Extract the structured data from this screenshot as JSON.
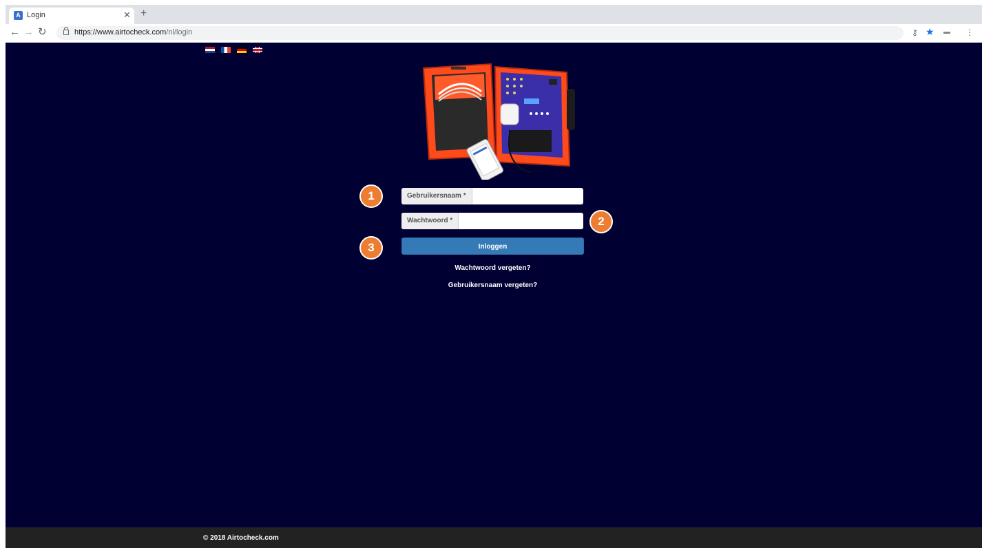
{
  "browser": {
    "tab_title": "Login",
    "tab_favicon_letter": "A",
    "url_host": "https://www.airtocheck.com",
    "url_path": "/nl/login"
  },
  "languages": [
    "Nederlands",
    "Français",
    "Deutsch",
    "English"
  ],
  "form": {
    "username_label": "Gebruikersnaam *",
    "username_value": "",
    "password_label": "Wachtwoord *",
    "password_value": "",
    "login_button": "Inloggen",
    "forgot_password": "Wachtwoord vergeten?",
    "forgot_username": "Gebruikersnaam vergeten?"
  },
  "annotations": [
    "1",
    "2",
    "3"
  ],
  "footer": {
    "copyright": "© 2018 Airtocheck.com"
  },
  "colors": {
    "page_background": "#000033",
    "button": "#337ab7",
    "badge": "#ed7d31",
    "footer": "#222222"
  }
}
